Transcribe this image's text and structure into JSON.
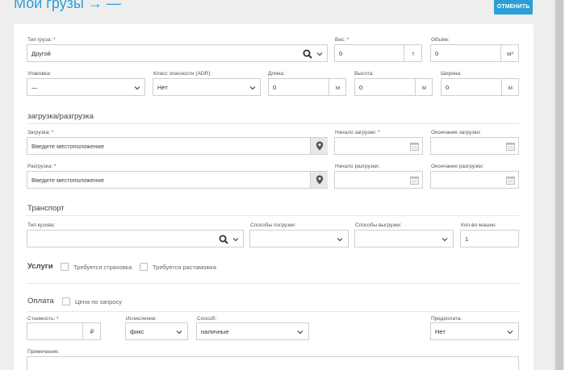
{
  "header": {
    "title": "Мои грузы → —",
    "cancel_label": "ОТМЕНИТЬ"
  },
  "cargo": {
    "type_label": "Тип груза: *",
    "type_value": "Другой",
    "weight_label": "Вес: *",
    "weight_value": "0",
    "weight_unit": "т",
    "volume_label": "Объём:",
    "volume_value": "0",
    "volume_unit": "м³",
    "packing_label": "Упаковка:",
    "packing_value": "—",
    "adr_label": "Класс опасности (ADR):",
    "adr_value": "Нет",
    "length_label": "Длина:",
    "length_value": "0",
    "length_unit": "м",
    "height_label": "Высота:",
    "height_value": "0",
    "height_unit": "м",
    "width_label": "Ширина:",
    "width_value": "0",
    "width_unit": "м"
  },
  "loading": {
    "section_title": "загрузка/разгрузка",
    "load_label": "Загрузка: *",
    "load_placeholder": "Введите местоположение",
    "load_start_label": "Начало загрузки: *",
    "load_end_label": "Окончание загрузки:",
    "unload_label": "Разгрузка: *",
    "unload_placeholder": "Введите местоположение",
    "unload_start_label": "Начало разгрузки:",
    "unload_end_label": "Окончание разгрузки:"
  },
  "transport": {
    "section_title": "Транспорт",
    "body_label": "Тип кузова:",
    "body_value": "",
    "load_methods_label": "Способы погрузки:",
    "load_methods_value": "",
    "unload_methods_label": "Способы выгрузки:",
    "unload_methods_value": "",
    "count_label": "Кол-во машин:",
    "count_value": "1"
  },
  "services": {
    "section_title": "Услуги",
    "insurance_label": "Требуется страховка",
    "customs_label": "Требуется растаможка"
  },
  "payment": {
    "section_title": "Оплата",
    "on_request_label": "Цена по запросу",
    "cost_label": "Стоимость: *",
    "cost_value": "",
    "currency": "₽",
    "calc_label": "Исчисление:",
    "calc_value": "фикс",
    "method_label": "Способ:",
    "method_value": "наличные",
    "prepay_label": "Предоплата:",
    "prepay_value": "Нет",
    "note_label": "Примечание:"
  }
}
